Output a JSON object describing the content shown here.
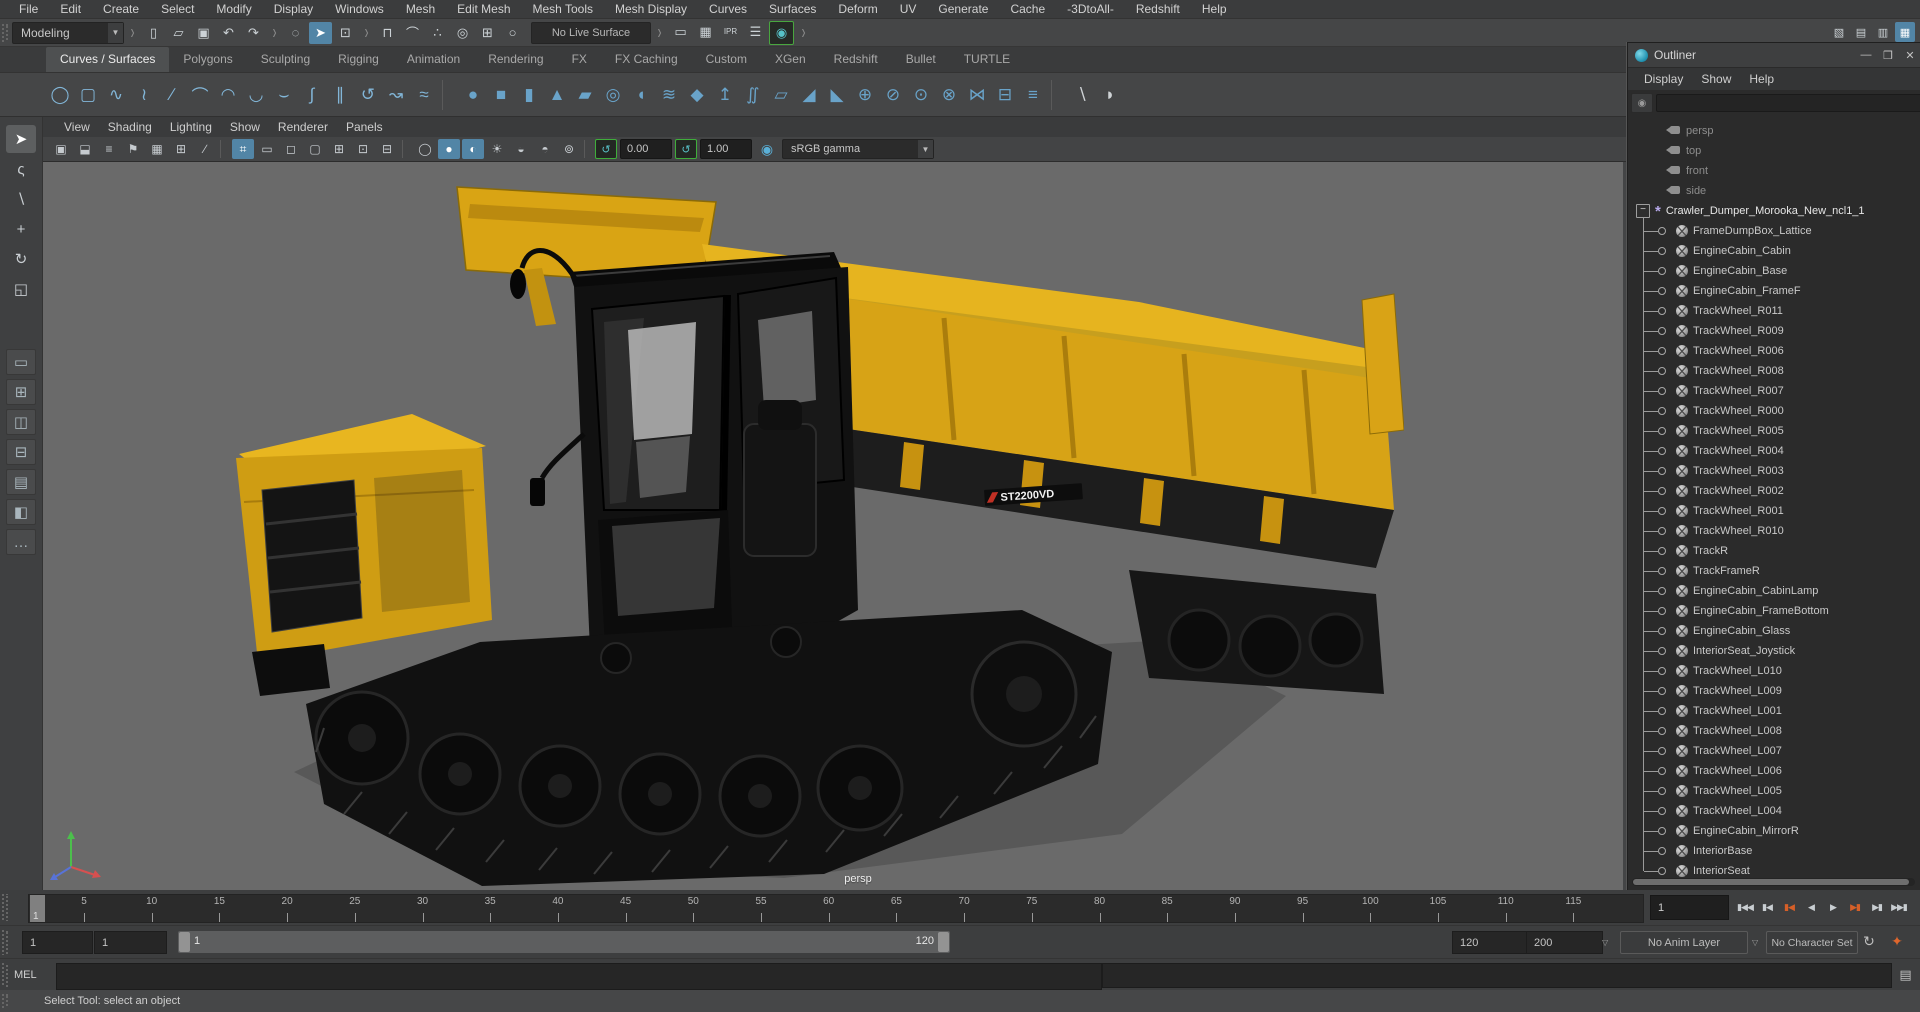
{
  "menu_bar": [
    "File",
    "Edit",
    "Create",
    "Select",
    "Modify",
    "Display",
    "Windows",
    "Mesh",
    "Edit Mesh",
    "Mesh Tools",
    "Mesh Display",
    "Curves",
    "Surfaces",
    "Deform",
    "UV",
    "Generate",
    "Cache",
    "-3DtoAll-",
    "Redshift",
    "Help"
  ],
  "status_line": {
    "menu_set": "Modeling",
    "no_live_surface": "No Live Surface",
    "file_tools": [
      {
        "name": "new-scene",
        "glyph": "▯"
      },
      {
        "name": "open-scene",
        "glyph": "▱"
      },
      {
        "name": "save-scene",
        "glyph": "▣"
      },
      {
        "name": "undo",
        "glyph": "↶"
      },
      {
        "name": "redo",
        "glyph": "↷"
      }
    ],
    "selection_masks": [
      {
        "name": "select-hierarchy",
        "glyph": "◌",
        "active": false
      },
      {
        "name": "select-object",
        "glyph": "➤",
        "active": true
      },
      {
        "name": "select-component",
        "glyph": "⊡",
        "active": false
      }
    ],
    "snap_tools": [
      {
        "name": "snap-to-grids",
        "glyph": "⊓"
      },
      {
        "name": "snap-to-curves",
        "glyph": "⌒"
      },
      {
        "name": "snap-to-points",
        "glyph": "∴"
      },
      {
        "name": "snap-to-projected-center",
        "glyph": "◎"
      },
      {
        "name": "snap-to-view-planes",
        "glyph": "⊞"
      },
      {
        "name": "make-object-live",
        "glyph": "○"
      }
    ],
    "render_tools": [
      {
        "name": "open-render-view",
        "glyph": "▭",
        "active": false
      },
      {
        "name": "render-current-frame",
        "glyph": "▦",
        "active": false
      },
      {
        "name": "ipr-render",
        "glyph": "IPR",
        "text": true,
        "active": false
      },
      {
        "name": "render-settings",
        "glyph": "☰",
        "active": false
      },
      {
        "name": "redshift-render-view",
        "glyph": "◉",
        "green": true,
        "active": true
      }
    ],
    "panel_toggles": [
      {
        "name": "modeling-toolkit",
        "glyph": "▧",
        "active": false
      },
      {
        "name": "attribute-editor",
        "glyph": "▤",
        "active": false
      },
      {
        "name": "tool-settings",
        "glyph": "▥",
        "active": false
      },
      {
        "name": "channel-box",
        "glyph": "▦",
        "active": true
      }
    ]
  },
  "shelf": {
    "tabs": [
      {
        "label": "Curves / Surfaces",
        "active": true
      },
      {
        "label": "Polygons",
        "active": false
      },
      {
        "label": "Sculpting",
        "active": false
      },
      {
        "label": "Rigging",
        "active": false
      },
      {
        "label": "Animation",
        "active": false
      },
      {
        "label": "Rendering",
        "active": false
      },
      {
        "label": "FX",
        "active": false
      },
      {
        "label": "FX Caching",
        "active": false
      },
      {
        "label": "Custom",
        "active": false
      },
      {
        "label": "XGen",
        "active": false
      },
      {
        "label": "Redshift",
        "active": false
      },
      {
        "label": "Bullet",
        "active": false
      },
      {
        "label": "TURTLE",
        "active": false
      }
    ],
    "icons": [
      {
        "name": "nurbs-circle",
        "glyph": "◯",
        "style": "o"
      },
      {
        "name": "nurbs-square",
        "glyph": "▢",
        "style": "o"
      },
      {
        "name": "cv-curve-tool",
        "glyph": "∿",
        "style": "o"
      },
      {
        "name": "ep-curve-tool",
        "glyph": "≀",
        "style": "o"
      },
      {
        "name": "pencil-curve-tool",
        "glyph": "∕",
        "style": "o"
      },
      {
        "name": "bezier-curve-tool",
        "glyph": "⌒",
        "style": "o"
      },
      {
        "name": "three-point-arc",
        "glyph": "◠",
        "style": "o"
      },
      {
        "name": "two-point-arc",
        "glyph": "◡",
        "style": "o"
      },
      {
        "name": "curve-fillet",
        "glyph": "⌣",
        "style": "o"
      },
      {
        "name": "attach-curves",
        "glyph": "∫",
        "style": "o"
      },
      {
        "name": "detach-curves",
        "glyph": "∥",
        "style": "o"
      },
      {
        "name": "open-close-curve",
        "glyph": "↺",
        "style": "o"
      },
      {
        "name": "extend-curve",
        "glyph": "↝",
        "style": "o"
      },
      {
        "name": "offset-curve",
        "glyph": "≈",
        "style": "o"
      },
      {
        "name": "separator",
        "style": "sep"
      },
      {
        "name": "nurbs-sphere",
        "glyph": "●",
        "style": "s"
      },
      {
        "name": "nurbs-cube",
        "glyph": "■",
        "style": "s"
      },
      {
        "name": "nurbs-cylinder",
        "glyph": "▮",
        "style": "s"
      },
      {
        "name": "nurbs-cone",
        "glyph": "▲",
        "style": "s"
      },
      {
        "name": "nurbs-plane",
        "glyph": "▰",
        "style": "s"
      },
      {
        "name": "nurbs-torus",
        "glyph": "◎",
        "style": "s"
      },
      {
        "name": "revolve",
        "glyph": "◖",
        "style": "s"
      },
      {
        "name": "loft",
        "glyph": "≋",
        "style": "s"
      },
      {
        "name": "planar",
        "glyph": "◆",
        "style": "s"
      },
      {
        "name": "extrude",
        "glyph": "↥",
        "style": "s"
      },
      {
        "name": "birail",
        "glyph": "∬",
        "style": "s"
      },
      {
        "name": "boundary",
        "glyph": "▱",
        "style": "s"
      },
      {
        "name": "bevel",
        "glyph": "◢",
        "style": "s"
      },
      {
        "name": "bevel-plus",
        "glyph": "◣",
        "style": "s"
      },
      {
        "name": "project-curve",
        "glyph": "⊕",
        "style": "s"
      },
      {
        "name": "trim-tool",
        "glyph": "⊘",
        "style": "s"
      },
      {
        "name": "untrim",
        "glyph": "⊙",
        "style": "s"
      },
      {
        "name": "intersect-surfaces",
        "glyph": "⊗",
        "style": "s"
      },
      {
        "name": "attach-surfaces",
        "glyph": "⋈",
        "style": "s"
      },
      {
        "name": "detach-surfaces",
        "glyph": "⊟",
        "style": "s"
      },
      {
        "name": "insert-isoparm",
        "glyph": "≡",
        "style": "s"
      },
      {
        "name": "separator",
        "style": "sep"
      },
      {
        "name": "paint-effects-brush",
        "glyph": "∖",
        "style": "p"
      },
      {
        "name": "sculpt-surfaces",
        "glyph": "◗",
        "style": "p"
      }
    ]
  },
  "tool_box": {
    "tools": [
      {
        "name": "select-tool",
        "glyph": "➤",
        "active": true
      },
      {
        "name": "lasso-tool",
        "glyph": "ς",
        "active": false
      },
      {
        "name": "paint-select-tool",
        "glyph": "∖",
        "active": false
      },
      {
        "name": "move-tool",
        "glyph": "+",
        "active": false
      },
      {
        "name": "rotate-tool",
        "glyph": "↻",
        "active": false
      },
      {
        "name": "scale-tool",
        "glyph": "◱",
        "active": false
      }
    ],
    "layouts": [
      {
        "name": "layout-single-pane",
        "glyph": "▭"
      },
      {
        "name": "layout-four-panes",
        "glyph": "⊞"
      },
      {
        "name": "layout-persp-outliner",
        "glyph": "◫"
      },
      {
        "name": "layout-persp-graph",
        "glyph": "⊟"
      },
      {
        "name": "layout-hypershade-persp",
        "glyph": "▤"
      },
      {
        "name": "layout-persp-uv",
        "glyph": "◧"
      }
    ],
    "more_layouts": "…"
  },
  "viewport": {
    "menus": [
      "View",
      "Shading",
      "Lighting",
      "Show",
      "Renderer",
      "Panels"
    ],
    "toolbar": [
      {
        "name": "select-camera",
        "glyph": "▣"
      },
      {
        "name": "lock-camera",
        "glyph": "⬓"
      },
      {
        "name": "camera-attributes",
        "glyph": "≡"
      },
      {
        "name": "bookmarks",
        "glyph": "⚑"
      },
      {
        "name": "image-plane",
        "glyph": "▦"
      },
      {
        "name": "two-d-pan-zoom",
        "glyph": "⊞"
      },
      {
        "name": "grease-pencil",
        "glyph": "∕"
      },
      {
        "name": "separator",
        "sep": true
      },
      {
        "name": "grid",
        "glyph": "⌗",
        "active": true
      },
      {
        "name": "film-gate",
        "glyph": "▭"
      },
      {
        "name": "resolution-gate",
        "glyph": "◻"
      },
      {
        "name": "gate-mask",
        "glyph": "▢"
      },
      {
        "name": "field-chart",
        "glyph": "⊞"
      },
      {
        "name": "safe-action",
        "glyph": "⊡"
      },
      {
        "name": "safe-title",
        "glyph": "⊟"
      },
      {
        "name": "separator",
        "sep": true
      },
      {
        "name": "wireframe",
        "glyph": "◯"
      },
      {
        "name": "smooth-shade-all",
        "glyph": "●",
        "active": true
      },
      {
        "name": "textured",
        "glyph": "◐",
        "active": true
      },
      {
        "name": "use-all-lights",
        "glyph": "☀"
      },
      {
        "name": "shadows",
        "glyph": "◒"
      },
      {
        "name": "screen-space-ao",
        "glyph": "◓"
      },
      {
        "name": "motion-blur",
        "glyph": "⊚"
      },
      {
        "name": "separator",
        "sep": true
      }
    ],
    "exposure": "0.00",
    "gamma": "1.00",
    "view_transform": "sRGB gamma",
    "camera_label": "persp",
    "decal": "ST2200VD"
  },
  "outliner": {
    "title": "Outliner",
    "menus": [
      "Display",
      "Show",
      "Help"
    ],
    "cameras": [
      "persp",
      "top",
      "front",
      "side"
    ],
    "root": "Crawler_Dumper_Morooka_New_ncl1_1",
    "children": [
      "FrameDumpBox_Lattice",
      "EngineCabin_Cabin",
      "EngineCabin_Base",
      "EngineCabin_FrameF",
      "TrackWheel_R011",
      "TrackWheel_R009",
      "TrackWheel_R006",
      "TrackWheel_R008",
      "TrackWheel_R007",
      "TrackWheel_R000",
      "TrackWheel_R005",
      "TrackWheel_R004",
      "TrackWheel_R003",
      "TrackWheel_R002",
      "TrackWheel_R001",
      "TrackWheel_R010",
      "TrackR",
      "TrackFrameR",
      "EngineCabin_CabinLamp",
      "EngineCabin_FrameBottom",
      "EngineCabin_Glass",
      "InteriorSeat_Joystick",
      "TrackWheel_L010",
      "TrackWheel_L009",
      "TrackWheel_L001",
      "TrackWheel_L008",
      "TrackWheel_L007",
      "TrackWheel_L006",
      "TrackWheel_L005",
      "TrackWheel_L004",
      "EngineCabin_MirrorR",
      "InteriorBase",
      "InteriorSeat"
    ]
  },
  "timeline": {
    "ticks": [
      5,
      10,
      15,
      20,
      25,
      30,
      35,
      40,
      45,
      50,
      55,
      60,
      65,
      70,
      75,
      80,
      85,
      90,
      95,
      100,
      105,
      110,
      115
    ],
    "current_frame": "1",
    "marker_label": "1",
    "playback": [
      {
        "name": "go-to-start",
        "glyph": "▮◀◀"
      },
      {
        "name": "step-back-frame",
        "glyph": "▮◀"
      },
      {
        "name": "step-back-key",
        "glyph": "▮◀",
        "accent": true
      },
      {
        "name": "play-backwards",
        "glyph": "◀"
      },
      {
        "name": "play-forwards",
        "glyph": "▶"
      },
      {
        "name": "step-forward-key",
        "glyph": "▶▮",
        "accent": true
      },
      {
        "name": "step-forward-frame",
        "glyph": "▶▮"
      },
      {
        "name": "go-to-end",
        "glyph": "▶▶▮"
      }
    ],
    "fields": {
      "anim_start": "1",
      "play_start": "1",
      "play_end": "120",
      "anim_end": "200"
    },
    "range_bar": {
      "start": "1",
      "end": "120"
    },
    "anim_layer": "No Anim Layer",
    "character_set": "No Character Set"
  },
  "command_line": {
    "label": "MEL"
  },
  "help_line": {
    "text": "Select Tool: select an object"
  },
  "colors": {
    "accent_blue": "#5285a6",
    "key_orange": "#d65f28",
    "body_yellow": "#d7a316",
    "viewport_gray": "#6a6a6a"
  }
}
